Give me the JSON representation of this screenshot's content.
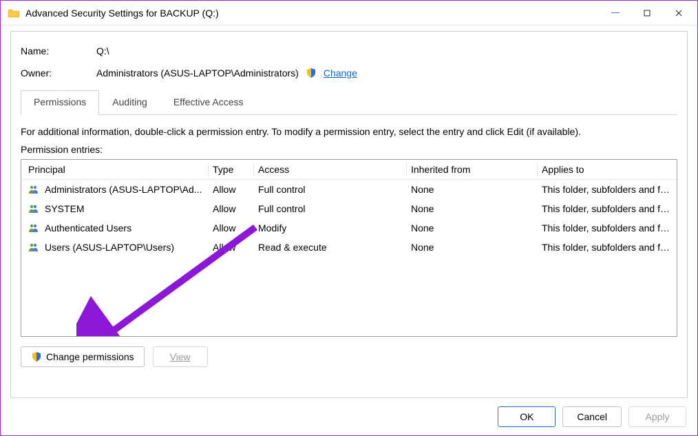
{
  "window": {
    "title": "Advanced Security Settings for BACKUP (Q:)"
  },
  "header": {
    "name_label": "Name:",
    "name_value": "Q:\\",
    "owner_label": "Owner:",
    "owner_value": "Administrators (ASUS-LAPTOP\\Administrators)",
    "change_link": "Change"
  },
  "tabs": {
    "permissions": "Permissions",
    "auditing": "Auditing",
    "effective": "Effective Access"
  },
  "info_text": "For additional information, double-click a permission entry. To modify a permission entry, select the entry and click Edit (if available).",
  "entries_label": "Permission entries:",
  "columns": {
    "principal": "Principal",
    "type": "Type",
    "access": "Access",
    "inherited": "Inherited from",
    "applies": "Applies to"
  },
  "entries": [
    {
      "principal": "Administrators (ASUS-LAPTOP\\Ad...",
      "type": "Allow",
      "access": "Full control",
      "inherited": "None",
      "applies": "This folder, subfolders and files"
    },
    {
      "principal": "SYSTEM",
      "type": "Allow",
      "access": "Full control",
      "inherited": "None",
      "applies": "This folder, subfolders and files"
    },
    {
      "principal": "Authenticated Users",
      "type": "Allow",
      "access": "Modify",
      "inherited": "None",
      "applies": "This folder, subfolders and files"
    },
    {
      "principal": "Users (ASUS-LAPTOP\\Users)",
      "type": "Allow",
      "access": "Read & execute",
      "inherited": "None",
      "applies": "This folder, subfolders and files"
    }
  ],
  "buttons": {
    "change_permissions": "Change permissions",
    "view": "View",
    "ok": "OK",
    "cancel": "Cancel",
    "apply": "Apply"
  }
}
